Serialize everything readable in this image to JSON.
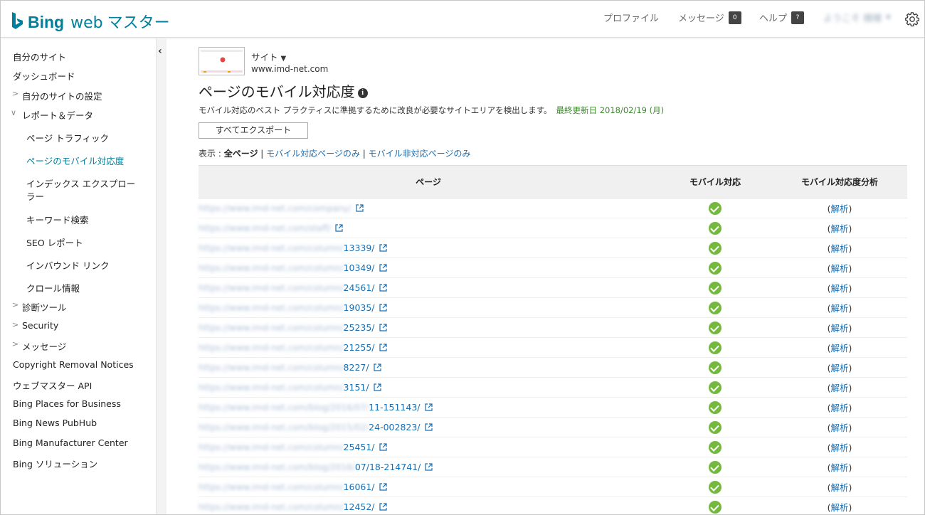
{
  "header": {
    "brand_name": "Bing",
    "brand_web": "web",
    "brand_master": "マスター",
    "nav": {
      "profile": "プロファイル",
      "messages": "メッセージ",
      "messages_count": "0",
      "help": "ヘルプ",
      "help_badge": "?",
      "welcome": "ようこそ 様様"
    }
  },
  "sidebar": {
    "items": [
      {
        "label": "自分のサイト"
      },
      {
        "label": "ダッシュボード"
      },
      {
        "label": "自分のサイトの設定"
      },
      {
        "label": "レポート＆データ"
      },
      {
        "label": "ページ トラフィック"
      },
      {
        "label": "ページのモバイル対応度"
      },
      {
        "label": "インデックス エクスプロー"
      },
      {
        "label": "ラー"
      },
      {
        "label": "キーワード検索"
      },
      {
        "label": "SEO レポート"
      },
      {
        "label": "インバウンド リンク"
      },
      {
        "label": "クロール情報"
      },
      {
        "label": "診断ツール"
      },
      {
        "label": "Security"
      },
      {
        "label": "メッセージ"
      },
      {
        "label": "Copyright Removal Notices"
      },
      {
        "label": "ウェブマスター API"
      },
      {
        "label": "Bing Places for Business"
      },
      {
        "label": "Bing News PubHub"
      },
      {
        "label": "Bing Manufacturer Center"
      },
      {
        "label": "Bing ソリューション"
      }
    ]
  },
  "site": {
    "label": "サイト",
    "url": "www.imd-net.com"
  },
  "page": {
    "title": "ページのモバイル対応度",
    "description": "モバイル対応のベスト プラクティスに準拠するために改良が必要なサイトエリアを検出します。",
    "last_updated": "最終更新日 2018/02/19 (月)",
    "export_button": "すべてエクスポート",
    "filter_prefix": "表示 : ",
    "filter_all": "全ページ",
    "filter_sep": " | ",
    "filter_mobile": "モバイル対応ページのみ",
    "filter_nonmobile": "モバイル非対応ページのみ"
  },
  "table": {
    "headers": {
      "page": "ページ",
      "mobile": "モバイル対応",
      "analysis": "モバイル対応度分析"
    },
    "analysis_open": "(",
    "analysis_link": "解析",
    "analysis_close": ")",
    "rows": [
      {
        "masked": "https://www.imd-net.com/company/",
        "visible": ""
      },
      {
        "masked": "https://www.imd-net.com/staff/",
        "visible": ""
      },
      {
        "masked": "https://www.imd-net.com/column/",
        "visible": "13339/"
      },
      {
        "masked": "https://www.imd-net.com/column/",
        "visible": "10349/"
      },
      {
        "masked": "https://www.imd-net.com/column/",
        "visible": "24561/"
      },
      {
        "masked": "https://www.imd-net.com/column/",
        "visible": "19035/"
      },
      {
        "masked": "https://www.imd-net.com/column/",
        "visible": "25235/"
      },
      {
        "masked": "https://www.imd-net.com/column/",
        "visible": "21255/"
      },
      {
        "masked": "https://www.imd-net.com/column/",
        "visible": "8227/"
      },
      {
        "masked": "https://www.imd-net.com/column/",
        "visible": "3151/"
      },
      {
        "masked": "https://www.imd-net.com/blog/2016/07/",
        "visible": "11-151143/"
      },
      {
        "masked": "https://www.imd-net.com/blog/2015/02/",
        "visible": "24-002823/"
      },
      {
        "masked": "https://www.imd-net.com/column/",
        "visible": "25451/"
      },
      {
        "masked": "https://www.imd-net.com/blog/2016/",
        "visible": "07/18-214741/"
      },
      {
        "masked": "https://www.imd-net.com/column/",
        "visible": "16061/"
      },
      {
        "masked": "https://www.imd-net.com/column/",
        "visible": "12452/"
      }
    ]
  },
  "colors": {
    "brand": "#00809d",
    "link": "#1a6eb0",
    "check": "#74b83e",
    "updated": "#3a8a2a"
  }
}
